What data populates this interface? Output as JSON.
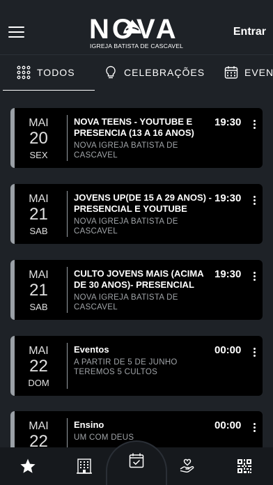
{
  "header": {
    "logo_word": "NOVA",
    "logo_sub": "IGREJA BATISTA DE CASCAVEL",
    "login_label": "Entrar"
  },
  "tabs": [
    {
      "label": "TODOS",
      "icon": "grid-icon",
      "active": true
    },
    {
      "label": "CELEBRAÇÕES",
      "icon": "lightbulb-icon",
      "active": false
    },
    {
      "label": "EVEN",
      "icon": "calendar-icon",
      "active": false
    }
  ],
  "events": [
    {
      "month": "MAI",
      "day": "20",
      "weekday": "SEX",
      "title": "NOVA TEENS - YOUTUBE E PRESENCIA (13 A 16 ANOS)",
      "subtitle": "NOVA IGREJA BATISTA DE CASCAVEL",
      "time": "19:30"
    },
    {
      "month": "MAI",
      "day": "21",
      "weekday": "SAB",
      "title": "JOVENS UP(DE 15 A 29 ANOS) - PRESENCIAL E YOUTUBE",
      "subtitle": "NOVA IGREJA BATISTA DE CASCAVEL",
      "time": "19:30"
    },
    {
      "month": "MAI",
      "day": "21",
      "weekday": "SAB",
      "title": "CULTO JOVENS MAIS (ACIMA DE 30 ANOS)- PRESENCIAL",
      "subtitle": "NOVA IGREJA BATISTA DE CASCAVEL",
      "time": "19:30"
    },
    {
      "month": "MAI",
      "day": "22",
      "weekday": "DOM",
      "title": "Eventos",
      "subtitle": "A PARTIR DE 5 DE JUNHO TEREMOS 5 CULTOS",
      "time": "00:00"
    },
    {
      "month": "MAI",
      "day": "22",
      "weekday": "",
      "title": "Ensino",
      "subtitle": "UM COM DEUS",
      "time": "00:00"
    }
  ],
  "bottom_nav": [
    {
      "icon": "star-icon",
      "active": false
    },
    {
      "icon": "building-icon",
      "active": false
    },
    {
      "icon": "calendar-check-icon",
      "active": true
    },
    {
      "icon": "hand-heart-icon",
      "active": false
    },
    {
      "icon": "qr-code-icon",
      "active": false
    }
  ],
  "colors": {
    "background": "#1e2227",
    "card": "#000000",
    "card_bar": "#9aa0a6",
    "subtitle": "#a0a4a8"
  }
}
